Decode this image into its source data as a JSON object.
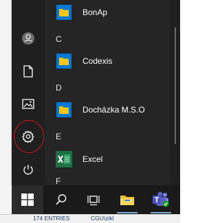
{
  "start_menu": {
    "apps": [
      {
        "type": "app",
        "label": "BonAp",
        "icon": "folder-icon"
      },
      {
        "type": "header",
        "label": "C"
      },
      {
        "type": "app",
        "label": "Codexis",
        "icon": "folder-icon"
      },
      {
        "type": "header",
        "label": "D"
      },
      {
        "type": "app",
        "label": "Docházka M.S.O",
        "icon": "folder-icon"
      },
      {
        "type": "header",
        "label": "E"
      },
      {
        "type": "app",
        "label": "Excel",
        "icon": "excel-icon"
      },
      {
        "type": "header",
        "label": "F"
      }
    ],
    "rail": [
      "user-avatar-icon",
      "documents-icon",
      "pictures-icon",
      "settings-gear-icon",
      "power-icon"
    ]
  },
  "taskbar": {
    "buttons": [
      "windows-start-icon",
      "search-icon",
      "task-view-icon",
      "file-explorer-icon",
      "teams-icon"
    ]
  },
  "status_bar": {
    "entries": "174 ENTRIES",
    "path": "CGU\\zikl"
  },
  "colors": {
    "start_bg": "#252525",
    "rail_bg": "#1f1f1f",
    "taskbar_bg": "#1a1a1a",
    "folder_yellow": "#f5c518",
    "excel_green": "#1e7145",
    "annotation_red": "#d8141c",
    "teams_purple": "#5b5fc7"
  }
}
